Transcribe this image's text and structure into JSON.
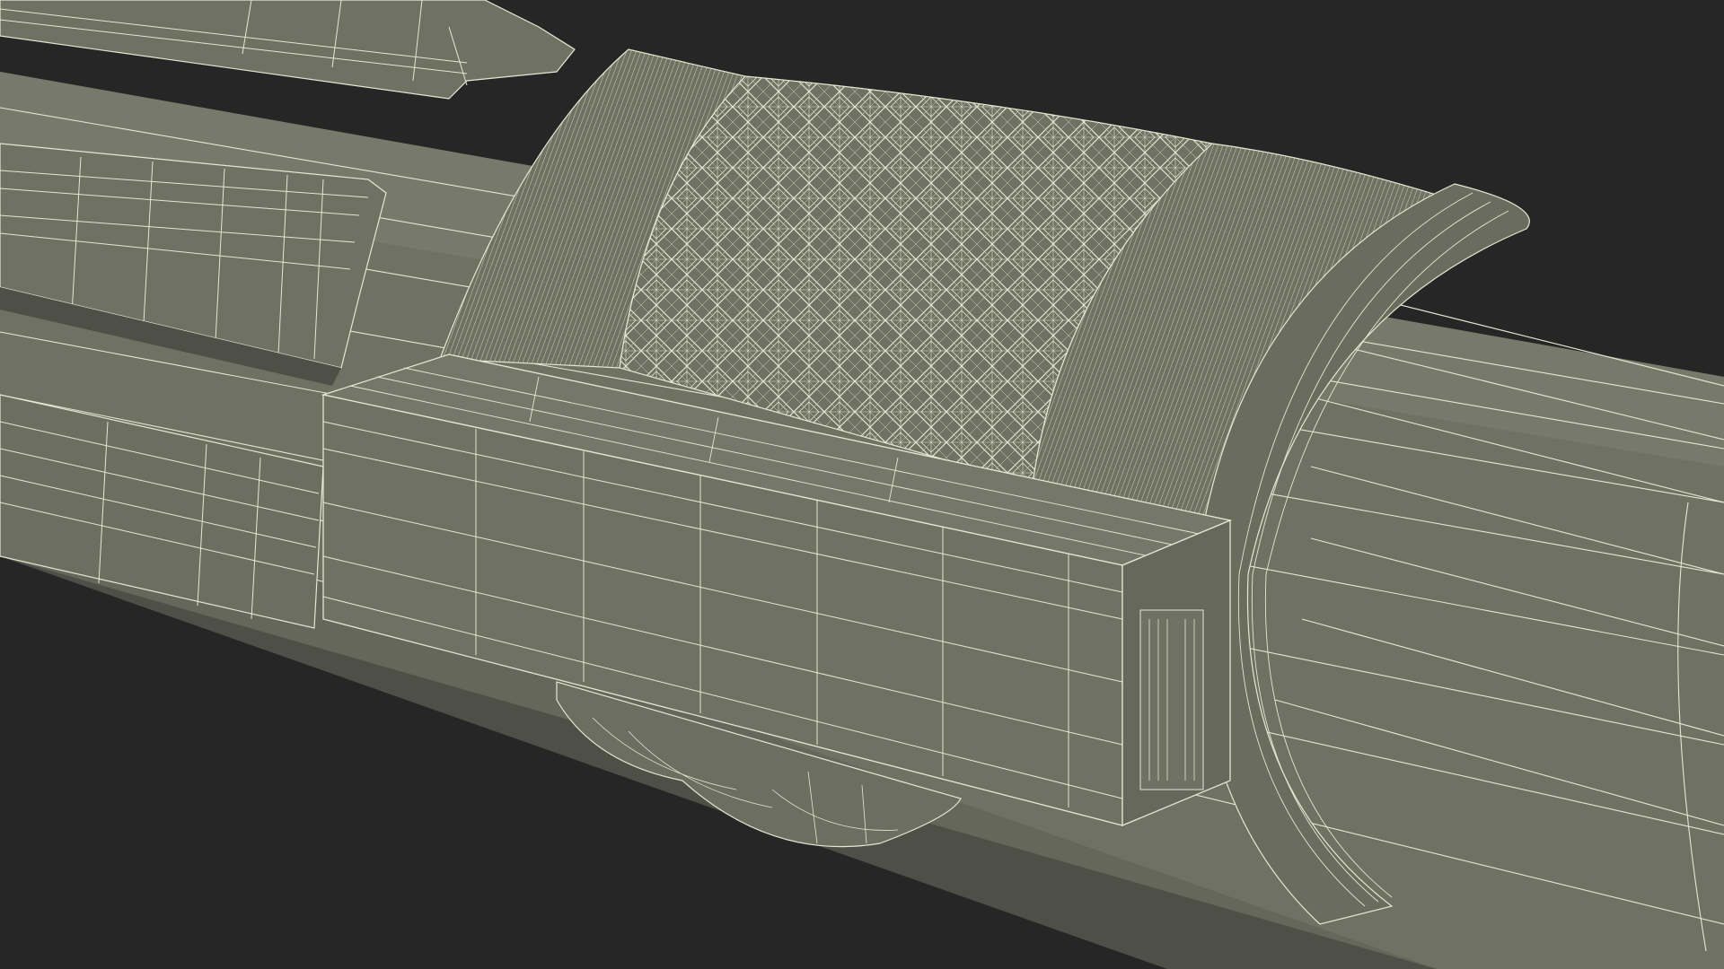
{
  "scene": {
    "subject": "wireframe-3d-model-render",
    "colors": {
      "background": "#262626",
      "body_fill": "#6f7262",
      "body_fill_dark": "#62655a",
      "body_fill_light": "#7a7e6d",
      "wire": "#e6e6d2",
      "wire_dim": "#c9c9b4"
    }
  }
}
